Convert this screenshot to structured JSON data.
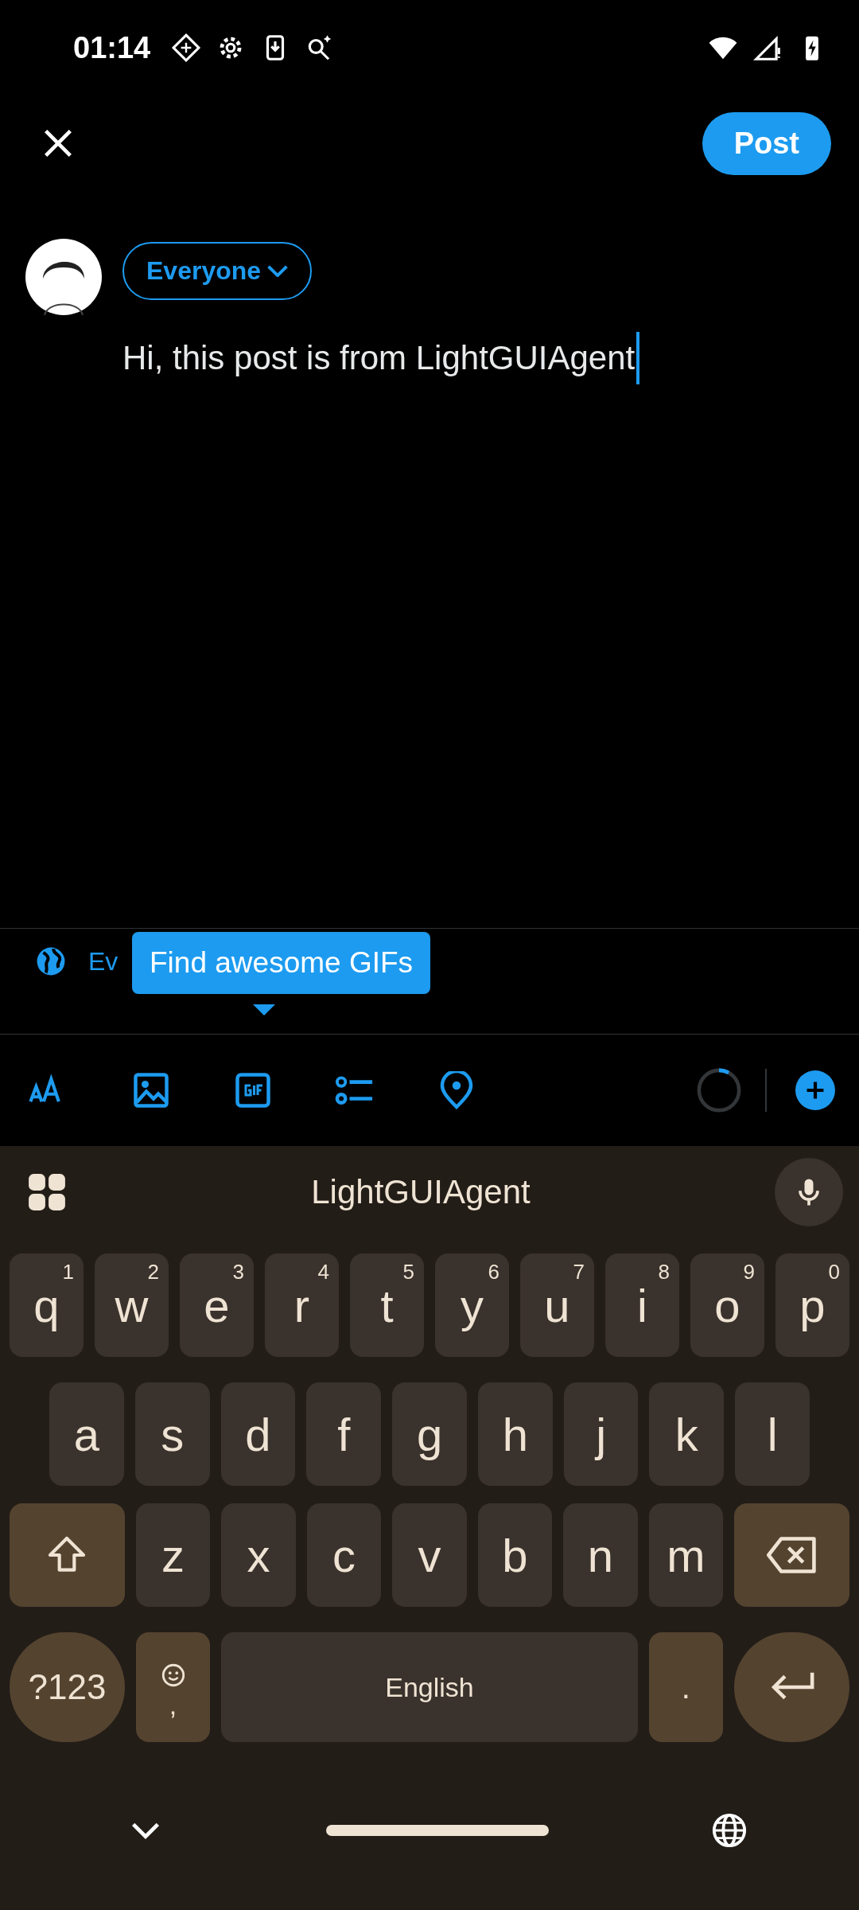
{
  "status_bar": {
    "time": "01:14"
  },
  "header": {
    "post_button": "Post"
  },
  "composer": {
    "audience": "Everyone",
    "text": "Hi, this post is from LightGUIAgent"
  },
  "reply_setting": "Ev",
  "tooltip": "Find awesome GIFs",
  "toolbar": {
    "counter": {
      "level": 0.08
    }
  },
  "keyboard": {
    "suggestion": "LightGUIAgent",
    "rows": [
      {
        "keys": [
          {
            "kind": "letter",
            "label": "q",
            "hint": "1"
          },
          {
            "kind": "letter",
            "label": "w",
            "hint": "2"
          },
          {
            "kind": "letter",
            "label": "e",
            "hint": "3"
          },
          {
            "kind": "letter",
            "label": "r",
            "hint": "4"
          },
          {
            "kind": "letter",
            "label": "t",
            "hint": "5"
          },
          {
            "kind": "letter",
            "label": "y",
            "hint": "6"
          },
          {
            "kind": "letter",
            "label": "u",
            "hint": "7"
          },
          {
            "kind": "letter",
            "label": "i",
            "hint": "8"
          },
          {
            "kind": "letter",
            "label": "o",
            "hint": "9"
          },
          {
            "kind": "letter",
            "label": "p",
            "hint": "0"
          }
        ]
      },
      {
        "keys": [
          {
            "kind": "letter",
            "label": "a"
          },
          {
            "kind": "letter",
            "label": "s"
          },
          {
            "kind": "letter",
            "label": "d"
          },
          {
            "kind": "letter",
            "label": "f"
          },
          {
            "kind": "letter",
            "label": "g"
          },
          {
            "kind": "letter",
            "label": "h"
          },
          {
            "kind": "letter",
            "label": "j"
          },
          {
            "kind": "letter",
            "label": "k"
          },
          {
            "kind": "letter",
            "label": "l"
          }
        ]
      },
      {
        "keys": [
          {
            "kind": "shift"
          },
          {
            "kind": "letter",
            "label": "z"
          },
          {
            "kind": "letter",
            "label": "x"
          },
          {
            "kind": "letter",
            "label": "c"
          },
          {
            "kind": "letter",
            "label": "v"
          },
          {
            "kind": "letter",
            "label": "b"
          },
          {
            "kind": "letter",
            "label": "n"
          },
          {
            "kind": "letter",
            "label": "m"
          },
          {
            "kind": "backspace"
          }
        ]
      },
      {
        "keys": [
          {
            "kind": "symbols",
            "label": "?123"
          },
          {
            "kind": "comma",
            "label": ","
          },
          {
            "kind": "space",
            "label": "English"
          },
          {
            "kind": "period",
            "label": "."
          },
          {
            "kind": "enter"
          }
        ]
      }
    ]
  }
}
